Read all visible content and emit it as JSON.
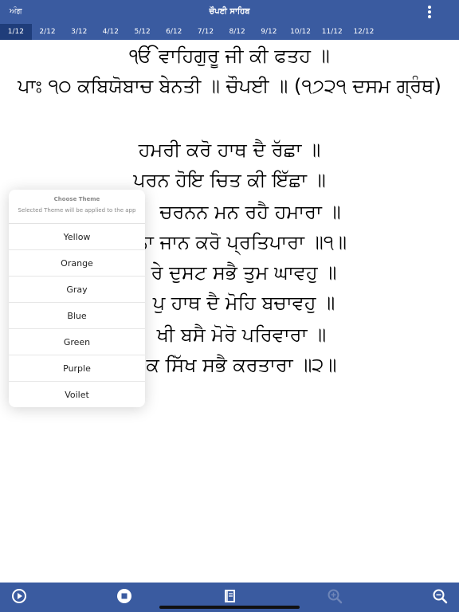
{
  "header": {
    "back_label": "ਅੰਗ",
    "title": "ਚੌਪਈ ਸਾਹਿਬ",
    "menu_icon": "more-vertical-icon"
  },
  "tabs": [
    {
      "label": "1/12",
      "active": true
    },
    {
      "label": "2/12",
      "active": false
    },
    {
      "label": "3/12",
      "active": false
    },
    {
      "label": "4/12",
      "active": false
    },
    {
      "label": "5/12",
      "active": false
    },
    {
      "label": "6/12",
      "active": false
    },
    {
      "label": "7/12",
      "active": false
    },
    {
      "label": "8/12",
      "active": false
    },
    {
      "label": "9/12",
      "active": false
    },
    {
      "label": "10/12",
      "active": false
    },
    {
      "label": "11/12",
      "active": false
    },
    {
      "label": "12/12",
      "active": false
    }
  ],
  "content": {
    "heading1": "ੴ ਵਾਹਿਗੁਰੂ ਜੀ ਕੀ ਫਤਹ ॥",
    "heading2": "ਪਾਃ ੧੦ ਕਬਿਯੋਬਾਚ ਬੇਨਤੀ ॥ ਚੌਪਈ ॥ (੧੭੨੧ ਦਸਮ ਗ੍ਰੰਥ)",
    "verses": [
      "ਹਮਰੀ ਕਰੋ ਹਾਥ ਦੈ ਰੱਛਾ ॥",
      "ਪਰਨ ਹੋਇ ਚਿਤ ਕੀ ਇੱਛਾ ॥",
      "ਚਰਨਨ ਮਨ ਰਹੈ ਹਮਾਰਾ ॥",
      "ਨਾ ਜਾਨ ਕਰੋ ਪ੍ਰਤਿਪਾਰਾ ॥੧॥",
      "ਰੇ ਦੁਸਟ ਸਭੈ ਤੁਮ ਘਾਵਹੁ ॥",
      "ਪੁ ਹਾਥ ਦੈ ਮੋਹਿ ਬਚਾਵਹੁ ॥",
      "ਖੀ ਬਸੈ ਮੋਰੋ ਪਰਿਵਾਰਾ ॥",
      "ਕ ਸਿੱਖ ਸਭੈ ਕਰਤਾਰਾ ॥੨॥"
    ]
  },
  "theme_popup": {
    "title": "Choose Theme",
    "subtitle": "Selected Theme will be applied to the app",
    "options": [
      "Yellow",
      "Orange",
      "Gray",
      "Blue",
      "Green",
      "Purple",
      "Voilet"
    ]
  },
  "bottom_bar": {
    "icons": [
      "play-icon",
      "stop-icon",
      "book-icon",
      "zoom-in-icon",
      "zoom-out-icon"
    ]
  },
  "colors": {
    "bar": "#3a5ba0",
    "active_tab": "#1f3d7a"
  }
}
